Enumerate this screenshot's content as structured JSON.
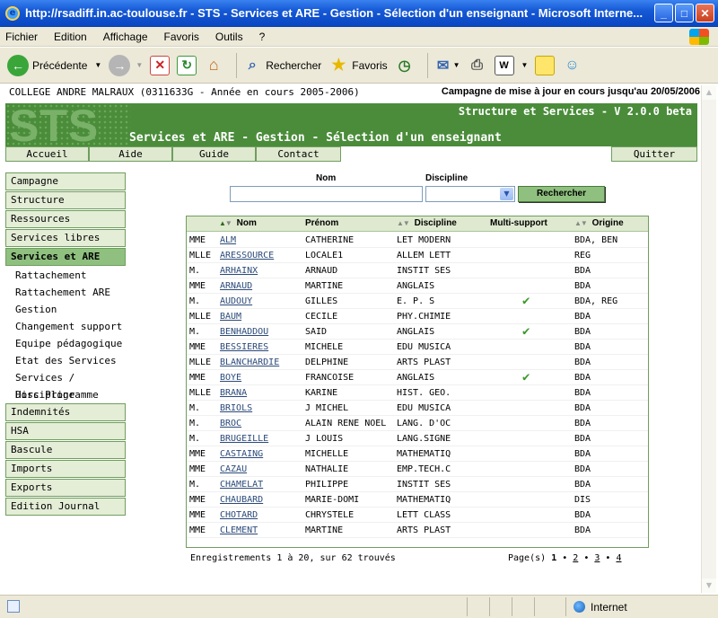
{
  "window": {
    "title": "http://rsadiff.in.ac-toulouse.fr - STS - Services et ARE - Gestion - Sélection d'un enseignant - Microsoft Interne..."
  },
  "menubar": [
    "Fichier",
    "Edition",
    "Affichage",
    "Favoris",
    "Outils",
    "?"
  ],
  "toolbar": {
    "back_label": "Précédente",
    "search_label": "Rechercher",
    "favorites_label": "Favoris"
  },
  "header": {
    "college": "COLLEGE ANDRE MALRAUX (0311633G - Année en cours 2005-2006)",
    "campagne": "Campagne de mise à jour en cours jusqu'au 20/05/2006",
    "logo": "STS",
    "version": "Structure et Services - V 2.0.0 beta",
    "page_title": "Services et ARE - Gestion - Sélection d'un enseignant"
  },
  "tabs": [
    "Accueil",
    "Aide",
    "Guide",
    "Contact",
    "Quitter"
  ],
  "sidebar": {
    "sections_top": [
      "Campagne",
      "Structure",
      "Ressources",
      "Services libres",
      "Services et ARE"
    ],
    "subitems": [
      "Rattachement",
      "Rattachement ARE",
      "Gestion",
      "Changement support",
      "Equipe pédagogique",
      "Etat des Services",
      "Services / Discipline",
      "Hors Programme"
    ],
    "sections_bottom": [
      "Indemnités",
      "HSA",
      "Bascule",
      "Imports",
      "Exports",
      "Edition Journal"
    ]
  },
  "search": {
    "nom_label": "Nom",
    "discipline_label": "Discipline",
    "nom_value": "",
    "discipline_value": "",
    "button_label": "Rechercher"
  },
  "table": {
    "columns": {
      "nom": "Nom",
      "prenom": "Prénom",
      "discipline": "Discipline",
      "multi": "Multi-support",
      "origine": "Origine"
    },
    "rows": [
      {
        "civ": "MME",
        "nom": "ALM",
        "prenom": "CATHERINE",
        "disc": "LET MODERN",
        "multi": false,
        "orig": "BDA, BEN"
      },
      {
        "civ": "MLLE",
        "nom": "ARESSOURCE",
        "prenom": "LOCALE1",
        "disc": "ALLEM LETT",
        "multi": false,
        "orig": "REG"
      },
      {
        "civ": "M.",
        "nom": "ARHAINX",
        "prenom": "ARNAUD",
        "disc": "INSTIT SES",
        "multi": false,
        "orig": "BDA"
      },
      {
        "civ": "MME",
        "nom": "ARNAUD",
        "prenom": "MARTINE",
        "disc": "ANGLAIS",
        "multi": false,
        "orig": "BDA"
      },
      {
        "civ": "M.",
        "nom": "AUDOUY",
        "prenom": "GILLES",
        "disc": "E. P. S",
        "multi": true,
        "orig": "BDA, REG"
      },
      {
        "civ": "MLLE",
        "nom": "BAUM",
        "prenom": "CECILE",
        "disc": "PHY.CHIMIE",
        "multi": false,
        "orig": "BDA"
      },
      {
        "civ": "M.",
        "nom": "BENHADDOU",
        "prenom": "SAID",
        "disc": "ANGLAIS",
        "multi": true,
        "orig": "BDA"
      },
      {
        "civ": "MME",
        "nom": "BESSIERES",
        "prenom": "MICHELE",
        "disc": "EDU MUSICA",
        "multi": false,
        "orig": "BDA"
      },
      {
        "civ": "MLLE",
        "nom": "BLANCHARDIE",
        "prenom": "DELPHINE",
        "disc": "ARTS PLAST",
        "multi": false,
        "orig": "BDA"
      },
      {
        "civ": "MME",
        "nom": "BOYE",
        "prenom": "FRANCOISE",
        "disc": "ANGLAIS",
        "multi": true,
        "orig": "BDA"
      },
      {
        "civ": "MLLE",
        "nom": "BRANA",
        "prenom": "KARINE",
        "disc": "HIST. GEO.",
        "multi": false,
        "orig": "BDA"
      },
      {
        "civ": "M.",
        "nom": "BRIOLS",
        "prenom": "J MICHEL",
        "disc": "EDU MUSICA",
        "multi": false,
        "orig": "BDA"
      },
      {
        "civ": "M.",
        "nom": "BROC",
        "prenom": "ALAIN RENE NOEL",
        "disc": "LANG. D'OC",
        "multi": false,
        "orig": "BDA"
      },
      {
        "civ": "M.",
        "nom": "BRUGEILLE",
        "prenom": "J LOUIS",
        "disc": "LANG.SIGNE",
        "multi": false,
        "orig": "BDA"
      },
      {
        "civ": "MME",
        "nom": "CASTAING",
        "prenom": "MICHELLE",
        "disc": "MATHEMATIQ",
        "multi": false,
        "orig": "BDA"
      },
      {
        "civ": "MME",
        "nom": "CAZAU",
        "prenom": "NATHALIE",
        "disc": "EMP.TECH.C",
        "multi": false,
        "orig": "BDA"
      },
      {
        "civ": "M.",
        "nom": "CHAMELAT",
        "prenom": "PHILIPPE",
        "disc": "INSTIT SES",
        "multi": false,
        "orig": "BDA"
      },
      {
        "civ": "MME",
        "nom": "CHAUBARD",
        "prenom": "MARIE-DOMI",
        "disc": "MATHEMATIQ",
        "multi": false,
        "orig": "DIS"
      },
      {
        "civ": "MME",
        "nom": "CHOTARD",
        "prenom": "CHRYSTELE",
        "disc": "LETT CLASS",
        "multi": false,
        "orig": "BDA"
      },
      {
        "civ": "MME",
        "nom": "CLEMENT",
        "prenom": "MARTINE",
        "disc": "ARTS PLAST",
        "multi": false,
        "orig": "BDA"
      }
    ]
  },
  "footer": {
    "count": "Enregistrements 1 à 20, sur 62 trouvés",
    "pager_label": "Page(s)",
    "pages": [
      "1",
      "2",
      "3",
      "4"
    ]
  },
  "statusbar": {
    "zone": "Internet"
  },
  "colors": {
    "accent": "#4a8c3a",
    "light": "#dfe9cf",
    "title": "#0a46c2"
  }
}
